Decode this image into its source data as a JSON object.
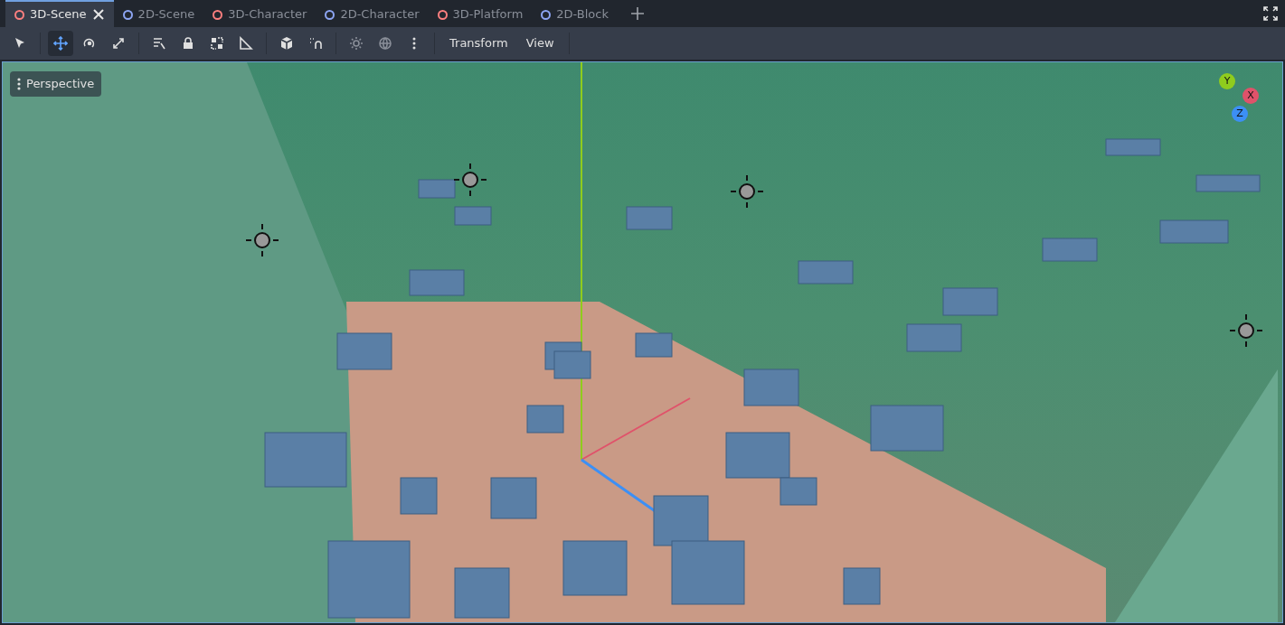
{
  "tabs": [
    {
      "label": "3D-Scene",
      "selected": true,
      "color": "#fc7f7f"
    },
    {
      "label": "2D-Scene",
      "selected": false,
      "color": "#8da5f3"
    },
    {
      "label": "3D-Character",
      "selected": false,
      "color": "#fc7f7f"
    },
    {
      "label": "2D-Character",
      "selected": false,
      "color": "#8da5f3"
    },
    {
      "label": "3D-Platform",
      "selected": false,
      "color": "#fc7f7f"
    },
    {
      "label": "2D-Block",
      "selected": false,
      "color": "#8da5f3"
    }
  ],
  "toolbar": {
    "tool_groups": [
      {
        "tools": [
          {
            "kind": "select",
            "selected": false
          }
        ]
      },
      {
        "tools": [
          {
            "kind": "move",
            "selected": true
          },
          {
            "kind": "rotate",
            "selected": false
          },
          {
            "kind": "scale",
            "selected": false
          }
        ]
      },
      {
        "tools": [
          {
            "kind": "list",
            "selected": false
          },
          {
            "kind": "lock",
            "selected": false
          },
          {
            "kind": "group",
            "selected": false
          },
          {
            "kind": "ruler",
            "selected": false
          }
        ]
      },
      {
        "tools": [
          {
            "kind": "cube",
            "selected": false
          },
          {
            "kind": "snap",
            "selected": false
          }
        ]
      },
      {
        "tools": [
          {
            "kind": "sun",
            "selected": false
          },
          {
            "kind": "globe",
            "selected": false
          },
          {
            "kind": "more",
            "selected": false
          }
        ]
      }
    ],
    "menus": [
      "Transform",
      "View"
    ]
  },
  "viewport": {
    "mode_label": "Perspective",
    "gizmo": [
      {
        "label": "Y",
        "color": "#8fcc1d"
      },
      {
        "label": "X",
        "color": "#e0526a"
      },
      {
        "label": "Z",
        "color": "#3c8ff5"
      }
    ]
  }
}
